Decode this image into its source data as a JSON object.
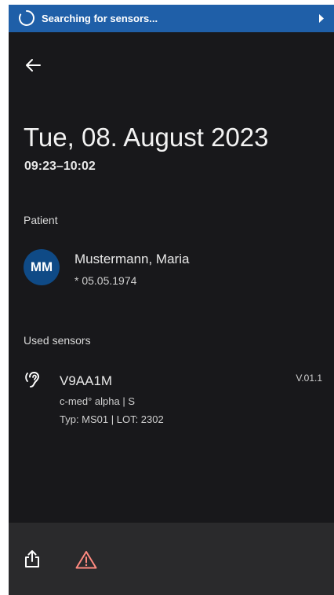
{
  "banner": {
    "text": "Searching for sensors...",
    "color": "#1f5fa8",
    "icons": [
      "loading-spinner-icon",
      "chevron-right-icon"
    ]
  },
  "nav": {
    "back_icon": "arrow-left-icon"
  },
  "session": {
    "date": "Tue, 08. August 2023",
    "time_range": "09:23–10:02"
  },
  "patient": {
    "section_label": "Patient",
    "initials": "MM",
    "name": "Mustermann, Maria",
    "dob": "* 05.05.1974",
    "avatar_color": "#0f4a86"
  },
  "sensors": {
    "section_label": "Used sensors",
    "items": [
      {
        "id": "V9AA1M",
        "model": "c-med° alpha | S",
        "type_lot": "Typ: MS01 | LOT: 2302",
        "version": "V.01.1",
        "icon": "hearing-ear-icon"
      }
    ]
  },
  "bottom_bar": {
    "icons": [
      "share-icon",
      "warning-icon"
    ],
    "warning_color": "#ff8a80"
  }
}
